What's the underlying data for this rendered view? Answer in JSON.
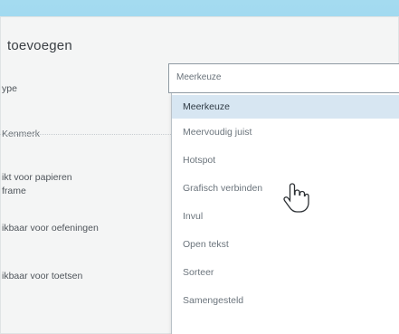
{
  "panel": {
    "title": "toevoegen"
  },
  "labels": {
    "type": "ype",
    "kenmerk": "Kenmerk",
    "papier": "ikt voor papieren\nframe",
    "oefeningen": "ikbaar voor oefeningen",
    "toetsen": "ikbaar voor toetsen"
  },
  "select": {
    "value": "Meerkeuze"
  },
  "dropdown": {
    "options": [
      "Meerkeuze",
      "Meervoudig juist",
      "Hotspot",
      "Grafisch verbinden",
      "Invul",
      "Open tekst",
      "Sorteer",
      "Samengesteld"
    ],
    "selected_index": 0
  },
  "colors": {
    "background": "#8ecfe8",
    "panel": "#f4f5f5",
    "selected_option": "#d7e6f2"
  },
  "icons": {
    "cursor": "hand-pointer-icon"
  }
}
